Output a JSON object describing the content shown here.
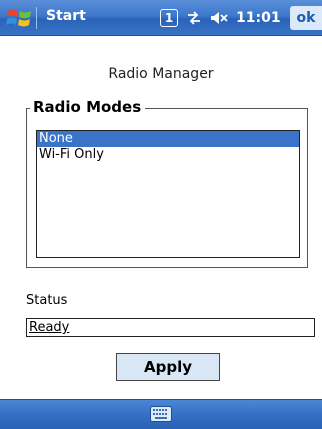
{
  "titlebar": {
    "title": "Start",
    "badge": "1",
    "clock": "11:01",
    "ok_label": "ok",
    "icons": [
      "windows-flag-icon",
      "connectivity-icon",
      "speaker-muted-icon"
    ]
  },
  "app_title": "Radio Manager",
  "radio_modes": {
    "legend": "Radio Modes",
    "items": [
      {
        "label": "None",
        "selected": true
      },
      {
        "label": "Wi-Fi Only",
        "selected": false
      }
    ]
  },
  "status": {
    "label": "Status",
    "value": "Ready"
  },
  "apply_label": "Apply",
  "bottombar": {
    "icons": [
      "keyboard-icon"
    ]
  },
  "colors": {
    "titlebar": "#3d78cc",
    "selection": "#3a73c8",
    "button_face": "#d9e6f5"
  }
}
